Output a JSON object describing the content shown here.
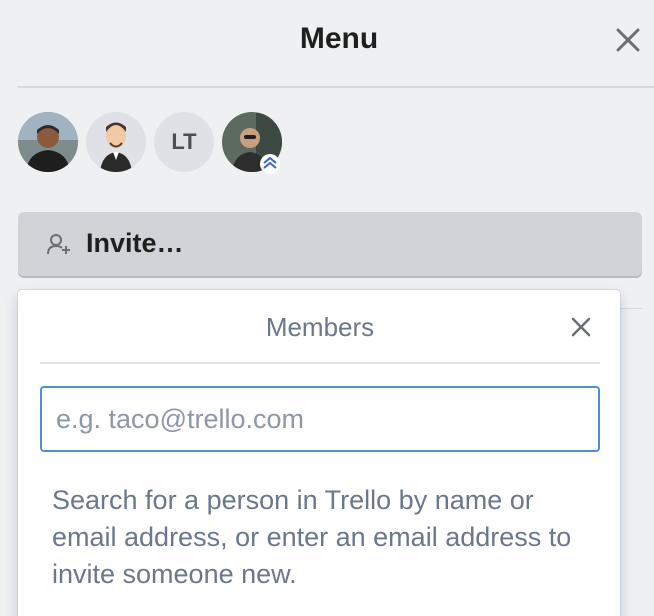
{
  "menu": {
    "title": "Menu",
    "close_icon": "close-icon"
  },
  "members": [
    {
      "name": "member-1",
      "type": "photo"
    },
    {
      "name": "member-2",
      "type": "cartoon"
    },
    {
      "name": "member-3",
      "type": "initials",
      "initials": "LT"
    },
    {
      "name": "member-4",
      "type": "photo",
      "admin": true
    }
  ],
  "invite": {
    "label": "Invite…",
    "icon": "add-user-icon"
  },
  "popover": {
    "title": "Members",
    "close_icon": "close-icon",
    "search": {
      "placeholder": "e.g. taco@trello.com",
      "value": ""
    },
    "helper_text": "Search for a person in Trello by name or email address, or enter an email address to invite someone new."
  },
  "colors": {
    "background": "#eef0f2",
    "invite_button": "#d0d4d9",
    "input_focus_border": "#4a90d9",
    "muted_text": "#6b778c"
  }
}
